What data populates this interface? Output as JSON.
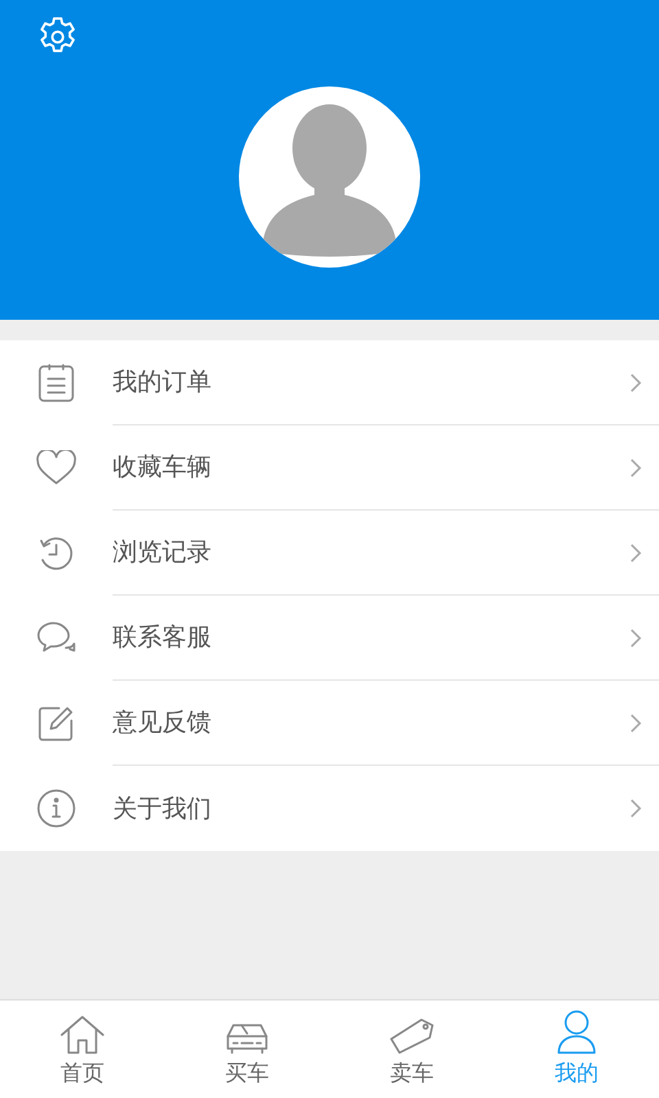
{
  "menu": [
    {
      "kind": "order",
      "label": "我的订单"
    },
    {
      "kind": "favorite",
      "label": "收藏车辆"
    },
    {
      "kind": "history",
      "label": "浏览记录"
    },
    {
      "kind": "service",
      "label": "联系客服"
    },
    {
      "kind": "feedback",
      "label": "意见反馈"
    },
    {
      "kind": "about",
      "label": "关于我们"
    }
  ],
  "tab_bar": [
    {
      "kind": "home",
      "label": "首页",
      "selected": false
    },
    {
      "kind": "buy",
      "label": "买车",
      "selected": false
    },
    {
      "kind": "sell",
      "label": "卖车",
      "selected": false
    },
    {
      "kind": "mine",
      "label": "我的",
      "selected": true
    }
  ]
}
